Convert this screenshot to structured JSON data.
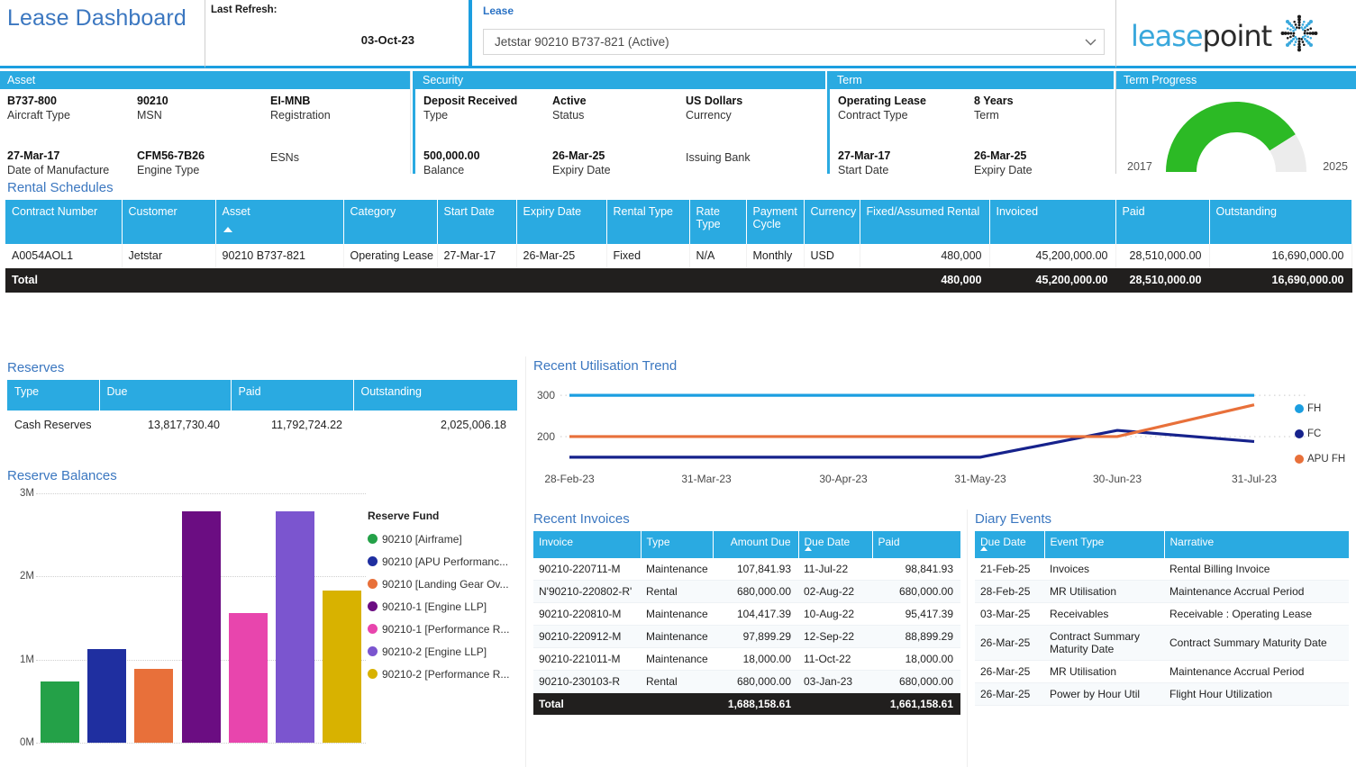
{
  "header": {
    "title": "Lease Dashboard",
    "last_refresh_label": "Last Refresh:",
    "last_refresh_value": "03-Oct-23",
    "lease_label": "Lease",
    "lease_selected": "Jetstar 90210 B737-821 (Active)",
    "logo_text_a": "lease",
    "logo_text_b": "point"
  },
  "panels": {
    "asset": {
      "title": "Asset",
      "fields": [
        {
          "value": "B737-800",
          "label": "Aircraft Type"
        },
        {
          "value": "90210",
          "label": "MSN"
        },
        {
          "value": "EI-MNB",
          "label": "Registration"
        },
        {
          "value": "27-Mar-17",
          "label": "Date of Manufacture"
        },
        {
          "value": "CFM56-7B26",
          "label": "Engine Type"
        },
        {
          "value": "",
          "label": "ESNs"
        }
      ]
    },
    "security": {
      "title": "Security",
      "fields": [
        {
          "value": "Deposit Received",
          "label": "Type"
        },
        {
          "value": "Active",
          "label": "Status"
        },
        {
          "value": "US Dollars",
          "label": "Currency"
        },
        {
          "value": "500,000.00",
          "label": "Balance"
        },
        {
          "value": "26-Mar-25",
          "label": "Expiry Date"
        },
        {
          "value": "",
          "label": "Issuing Bank"
        }
      ]
    },
    "term": {
      "title": "Term",
      "fields": [
        {
          "value": "Operating Lease",
          "label": "Contract Type"
        },
        {
          "value": "8 Years",
          "label": "Term"
        },
        {
          "value": "27-Mar-17",
          "label": "Start Date"
        },
        {
          "value": "26-Mar-25",
          "label": "Expiry Date"
        }
      ]
    },
    "term_progress": {
      "title": "Term Progress",
      "start_year": "2017",
      "end_year": "2025",
      "percent": 82,
      "fill_color": "#2cba25",
      "track_color": "#ececec"
    }
  },
  "rental_schedules": {
    "title": "Rental Schedules",
    "sort_column": "Asset",
    "columns": [
      "Contract Number",
      "Customer",
      "Asset",
      "Category",
      "Start Date",
      "Expiry Date",
      "Rental Type",
      "Rate Type",
      "Payment Cycle",
      "Currency",
      "Fixed/Assumed Rental",
      "Invoiced",
      "Paid",
      "Outstanding"
    ],
    "rows": [
      {
        "contract_number": "A0054AOL1",
        "customer": "Jetstar",
        "asset": "90210 B737-821",
        "category": "Operating Lease",
        "start_date": "27-Mar-17",
        "expiry_date": "26-Mar-25",
        "rental_type": "Fixed",
        "rate_type": "N/A",
        "payment_cycle": "Monthly",
        "currency": "USD",
        "fixed_assumed_rental": "480,000",
        "invoiced": "45,200,000.00",
        "paid": "28,510,000.00",
        "outstanding": "16,690,000.00"
      }
    ],
    "total": {
      "label": "Total",
      "fixed_assumed_rental": "480,000",
      "invoiced": "45,200,000.00",
      "paid": "28,510,000.00",
      "outstanding": "16,690,000.00"
    }
  },
  "reserves": {
    "title": "Reserves",
    "columns": [
      "Type",
      "Due",
      "Paid",
      "Outstanding"
    ],
    "rows": [
      {
        "type": "Cash Reserves",
        "due": "13,817,730.40",
        "paid": "11,792,724.22",
        "outstanding": "2,025,006.18"
      }
    ]
  },
  "reserve_balances": {
    "title": "Reserve Balances",
    "legend_title": "Reserve Fund"
  },
  "utilisation": {
    "title": "Recent Utilisation Trend"
  },
  "recent_invoices": {
    "title": "Recent Invoices",
    "columns": [
      "Invoice",
      "Type",
      "Amount Due",
      "Due Date",
      "Paid"
    ],
    "sort_column": "Due Date",
    "rows": [
      {
        "invoice": "90210-220711-M",
        "type": "Maintenance",
        "amount_due": "107,841.93",
        "due_date": "11-Jul-22",
        "paid": "98,841.93"
      },
      {
        "invoice": "N'90210-220802-R'",
        "type": "Rental",
        "amount_due": "680,000.00",
        "due_date": "02-Aug-22",
        "paid": "680,000.00"
      },
      {
        "invoice": "90210-220810-M",
        "type": "Maintenance",
        "amount_due": "104,417.39",
        "due_date": "10-Aug-22",
        "paid": "95,417.39"
      },
      {
        "invoice": "90210-220912-M",
        "type": "Maintenance",
        "amount_due": "97,899.29",
        "due_date": "12-Sep-22",
        "paid": "88,899.29"
      },
      {
        "invoice": "90210-221011-M",
        "type": "Maintenance",
        "amount_due": "18,000.00",
        "due_date": "11-Oct-22",
        "paid": "18,000.00"
      },
      {
        "invoice": "90210-230103-R",
        "type": "Rental",
        "amount_due": "680,000.00",
        "due_date": "03-Jan-23",
        "paid": "680,000.00"
      }
    ],
    "total": {
      "label": "Total",
      "amount_due": "1,688,158.61",
      "paid": "1,661,158.61"
    }
  },
  "diary_events": {
    "title": "Diary Events",
    "columns": [
      "Due Date",
      "Event Type",
      "Narrative"
    ],
    "sort_column": "Due Date",
    "rows": [
      {
        "due_date": "21-Feb-25",
        "event_type": "Invoices",
        "narrative": "Rental Billing Invoice"
      },
      {
        "due_date": "28-Feb-25",
        "event_type": "MR Utilisation",
        "narrative": "Maintenance Accrual Period"
      },
      {
        "due_date": "03-Mar-25",
        "event_type": "Receivables",
        "narrative": "Receivable : Operating Lease"
      },
      {
        "due_date": "26-Mar-25",
        "event_type": "Contract Summary Maturity Date",
        "narrative": "Contract Summary Maturity Date"
      },
      {
        "due_date": "26-Mar-25",
        "event_type": "MR Utilisation",
        "narrative": "Maintenance Accrual Period"
      },
      {
        "due_date": "26-Mar-25",
        "event_type": "Power by Hour Util",
        "narrative": "Flight Hour Utilization"
      }
    ]
  },
  "chart_data": [
    {
      "type": "bar",
      "name": "reserve-balances",
      "title": "Reserve Balances",
      "xlabel": "",
      "ylabel": "",
      "ylim": [
        0,
        3000000
      ],
      "ytick_labels": [
        "0M",
        "1M",
        "2M",
        "3M"
      ],
      "ytick_values": [
        0,
        1000000,
        2000000,
        3000000
      ],
      "grid": true,
      "legend_title": "Reserve Fund",
      "legend_position": "right",
      "categories": [
        "90210 [Airframe]",
        "90210 [APU Performanc...",
        "90210 [Landing Gear Ov...",
        "90210-1 [Engine LLP]",
        "90210-1 [Performance R...",
        "90210-2 [Engine LLP]",
        "90210-2 [Performance R..."
      ],
      "values": [
        740000,
        1130000,
        890000,
        2780000,
        1560000,
        2780000,
        1830000
      ],
      "colors": [
        "#24a148",
        "#1f2fa0",
        "#e8703a",
        "#6b0d82",
        "#e845ad",
        "#7b55cf",
        "#d8b200"
      ]
    },
    {
      "type": "line",
      "name": "recent-utilisation-trend",
      "title": "Recent Utilisation Trend",
      "xlabel": "",
      "ylabel": "",
      "ylim": [
        130,
        320
      ],
      "ytick_labels": [
        "200",
        "300"
      ],
      "ytick_values": [
        200,
        300
      ],
      "grid": true,
      "legend_position": "right",
      "x": [
        "28-Feb-23",
        "31-Mar-23",
        "30-Apr-23",
        "31-May-23",
        "30-Jun-23",
        "31-Jul-23"
      ],
      "series": [
        {
          "name": "FH",
          "color": "#1b9ee0",
          "values": [
            300,
            300,
            300,
            300,
            300,
            300
          ]
        },
        {
          "name": "FC",
          "color": "#16228c",
          "values": [
            150,
            150,
            150,
            150,
            215,
            188
          ]
        },
        {
          "name": "APU FH",
          "color": "#e8703a",
          "values": [
            200,
            200,
            200,
            200,
            200,
            277
          ]
        }
      ]
    }
  ]
}
